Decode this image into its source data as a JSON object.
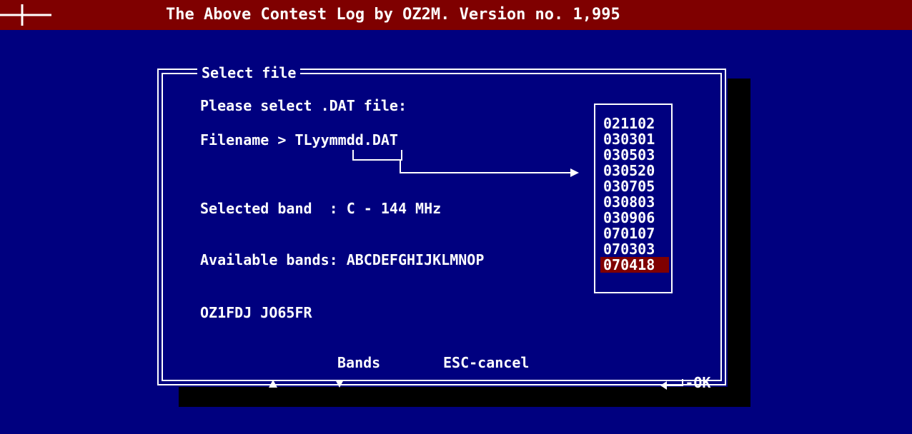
{
  "title_bar": {
    "text": "The Above Contest Log by OZ2M. Version no. 1,995"
  },
  "dialog": {
    "title": "Select file",
    "prompt": "Please select .DAT file:",
    "filename_line": "Filename > TLyymmdd.DAT",
    "selected_band_line": "Selected band  : C - 144 MHz",
    "available_bands_line": "Available bands: ABCDEFGHIJKLMNOP",
    "station_line": "OZ1FDJ JO65FR"
  },
  "file_list": {
    "items": [
      "021102",
      "030301",
      "030503",
      "030520",
      "030705",
      "030803",
      "030906",
      "070107",
      "070303",
      "070418"
    ],
    "selected_index": 9
  },
  "footer": {
    "bands_label": "Bands",
    "esc_label": "ESC-cancel",
    "ok_label": "-OK"
  },
  "colors": {
    "background": "#00007f",
    "title_bar": "#7f0000",
    "selection": "#7f0000",
    "text": "#ffffff",
    "shadow": "#000000"
  },
  "icons": {
    "menu": "cross-icon",
    "up": "arrow-up-icon",
    "down": "arrow-down-icon",
    "enter": "enter-key-icon"
  }
}
